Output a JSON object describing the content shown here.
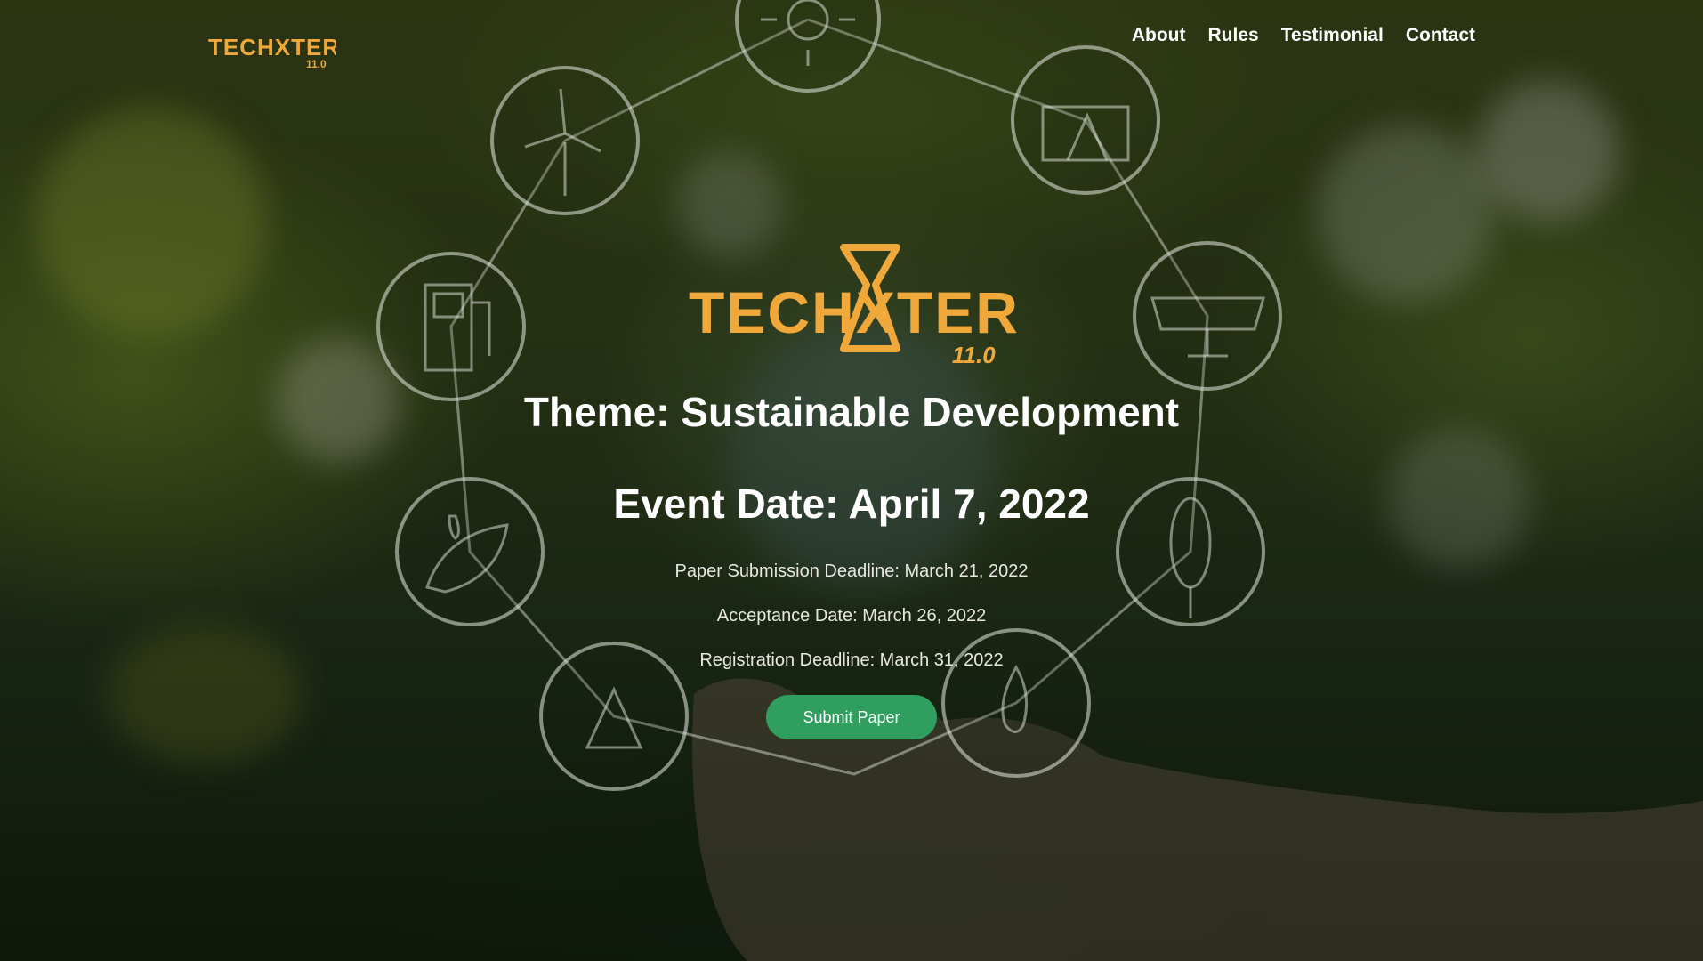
{
  "nav": {
    "logo_text": "TECHXTER",
    "logo_version": "11.0",
    "items": [
      {
        "label": "About"
      },
      {
        "label": "Rules"
      },
      {
        "label": "Testimonial"
      },
      {
        "label": "Contact"
      }
    ]
  },
  "hero": {
    "logo_text": "TECHXTER",
    "logo_version": "11.0",
    "theme": "Theme: Sustainable Development",
    "event_date": "Event Date: April 7, 2022",
    "details": [
      "Paper Submission Deadline: March 21, 2022",
      "Acceptance Date: March 26, 2022",
      "Registration Deadline: March 31, 2022"
    ],
    "cta_label": "Submit Paper"
  },
  "colors": {
    "logo_gold": "#f0a83a",
    "cta_green": "#2f9e5e",
    "text_white": "#ffffff"
  },
  "icons": [
    "sun-icon",
    "wind-turbine-icon",
    "oil-pump-icon",
    "fuel-station-icon",
    "solar-panel-icon",
    "water-leaf-icon",
    "corn-icon",
    "recycle-icon",
    "flame-icon"
  ]
}
